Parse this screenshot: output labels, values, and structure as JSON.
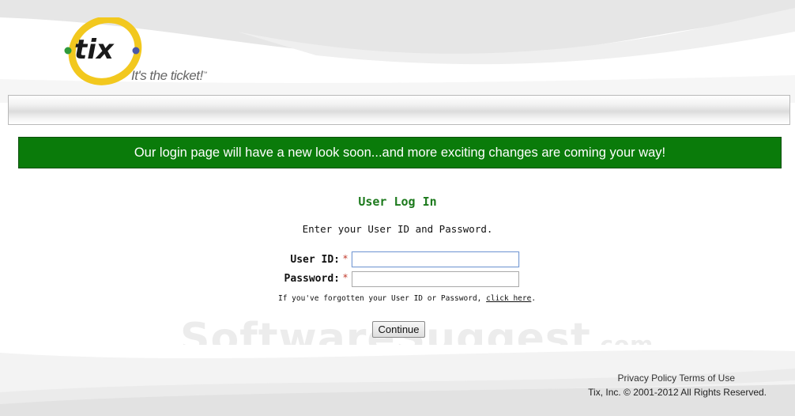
{
  "brand": {
    "logo_text": "tix",
    "tagline": "It's the ticket!",
    "tagline_mark": "™"
  },
  "banner": {
    "message": "Our login page will have a new look soon...and more exciting changes are coming your way!"
  },
  "login": {
    "title": "User Log In",
    "subtitle": "Enter your User ID and Password.",
    "user_id_label": "User ID:",
    "password_label": "Password:",
    "required_mark": "*",
    "user_id_value": "",
    "password_value": "",
    "forgot_text": "If you've forgotten your User ID or Password,",
    "forgot_link": "click here",
    "forgot_end": ".",
    "continue_label": "Continue"
  },
  "watermark": {
    "text": "SoftwareSuggest",
    "suffix": ".com"
  },
  "footer": {
    "privacy": "Privacy Policy",
    "terms": "Terms of Use",
    "copyright": "Tix, Inc. © 2001-2012 All Rights Reserved."
  },
  "colors": {
    "banner_bg": "#0a7b0a",
    "title_green": "#1d7a1d",
    "required_red": "#c0392b",
    "logo_yellow": "#f2c81e"
  },
  "icons": [
    "tix-logo-icon"
  ]
}
